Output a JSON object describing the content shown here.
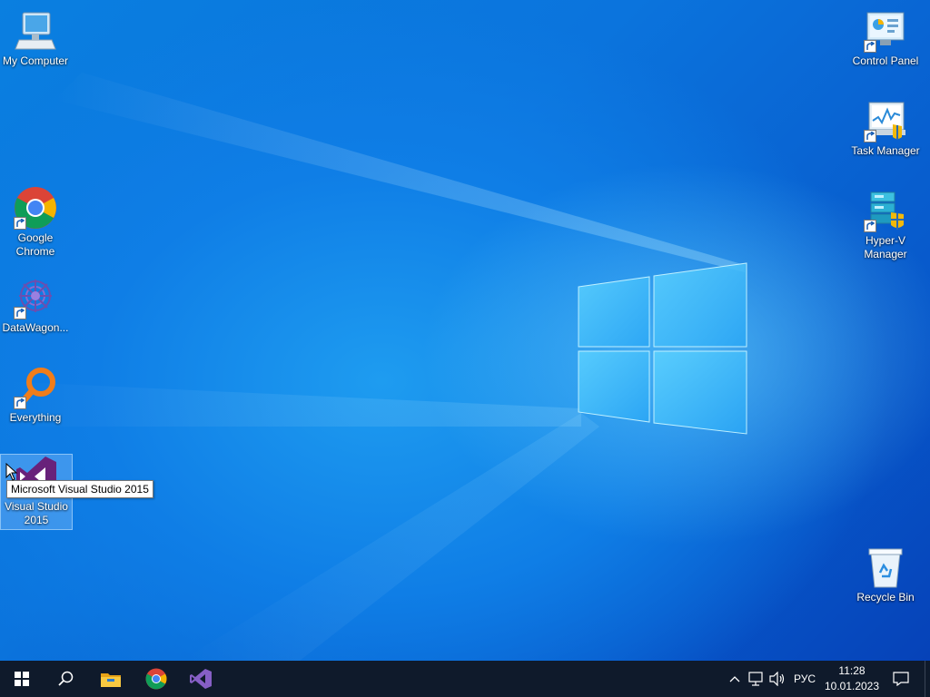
{
  "desktop": {
    "icons": [
      {
        "label": "My Computer",
        "icon": "computer-icon"
      },
      {
        "label": "Google\nChrome",
        "icon": "chrome-icon"
      },
      {
        "label": "DataWagon...",
        "icon": "datawagon-icon"
      },
      {
        "label": "Everything",
        "icon": "everything-search-icon"
      },
      {
        "label": "Visual Studio\n2015",
        "icon": "visual-studio-icon"
      },
      {
        "label": "Control Panel",
        "icon": "control-panel-icon"
      },
      {
        "label": "Task Manager",
        "icon": "task-manager-icon"
      },
      {
        "label": "Hyper-V\nManager",
        "icon": "hyper-v-icon"
      },
      {
        "label": "Recycle Bin",
        "icon": "recycle-bin-icon"
      }
    ],
    "tooltip": "Microsoft Visual Studio 2015"
  },
  "taskbar": {
    "pinned": [
      "start-icon",
      "search-icon",
      "file-explorer-icon",
      "chrome-icon",
      "visual-studio-icon"
    ],
    "tray": {
      "language": "РУС",
      "time": "11:28",
      "date": "10.01.2023"
    }
  },
  "colors": {
    "taskbar": "#0f1a2b",
    "desktop_blue": "#0b74dd",
    "vs_purple": "#68217a"
  }
}
